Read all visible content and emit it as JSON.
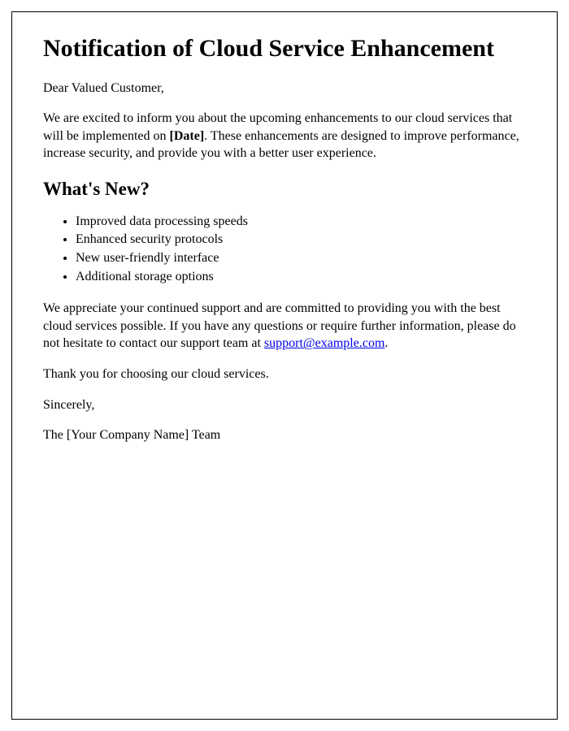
{
  "title": "Notification of Cloud Service Enhancement",
  "greeting": "Dear Valued Customer,",
  "intro_before": "We are excited to inform you about the upcoming enhancements to our cloud services that will be implemented on ",
  "intro_bold": "[Date]",
  "intro_after": ". These enhancements are designed to improve performance, increase security, and provide you with a better user experience.",
  "section_heading": "What's New?",
  "features": [
    "Improved data processing speeds",
    "Enhanced security protocols",
    "New user-friendly interface",
    "Additional storage options"
  ],
  "support_before": "We appreciate your continued support and are committed to providing you with the best cloud services possible. If you have any questions or require further information, please do not hesitate to contact our support team at ",
  "support_email": "support@example.com",
  "support_after": ".",
  "thanks": "Thank you for choosing our cloud services.",
  "closing": "Sincerely,",
  "signature": "The [Your Company Name] Team"
}
